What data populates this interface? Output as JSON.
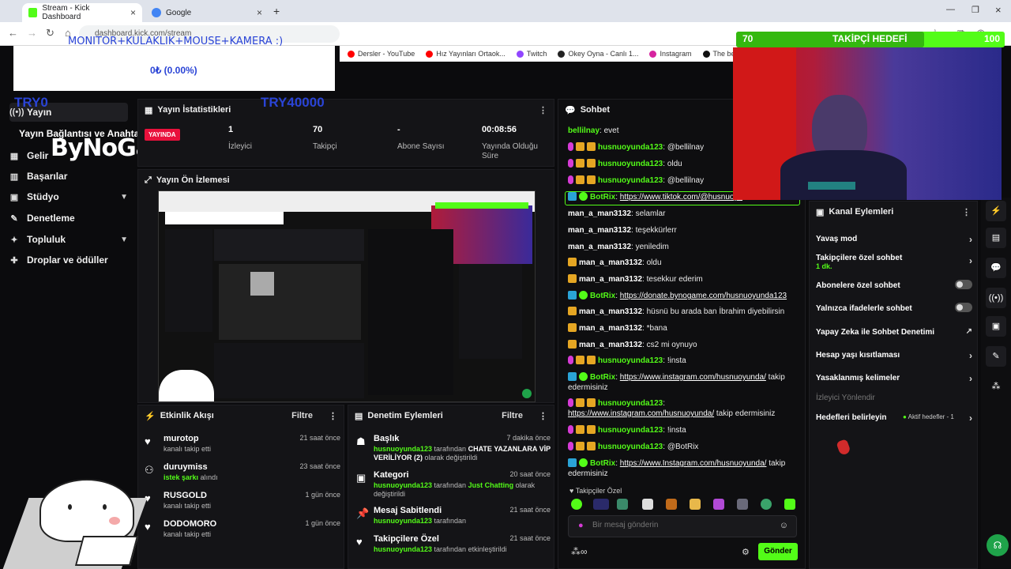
{
  "browser": {
    "tabs": [
      {
        "title": "Stream - Kick Dashboard",
        "active": true
      },
      {
        "title": "Google",
        "active": false
      }
    ],
    "address": "dashboard.kick.com/stream",
    "bookmarks": [
      "Dersler - YouTube",
      "Hız Yayınları Ortaok...",
      "Twitch",
      "Okey Oyna - Canlı 1...",
      "Instagram",
      "The best ChatBot a..."
    ]
  },
  "overlay": {
    "goal_title": "MONITOR+KULAKLIK+MOUSE+KAMERA :)",
    "goal_pct": "0₺ (0.00%)",
    "try_start": "TRY0",
    "try_end": "TRY40000",
    "follower_goal": {
      "current": "70",
      "title": "TAKİPÇİ HEDEFİ",
      "max": "100",
      "progress": 0.7
    },
    "bynogame_sub": "Yayın Bağlantısı ve Anahtarı",
    "bynogame_logo": "ByNoGame"
  },
  "sidebar": {
    "items": [
      {
        "label": "Yayın",
        "icon": "broadcast-icon"
      },
      {
        "label": "Gelir",
        "icon": "chart-icon"
      },
      {
        "label": "Başarılar",
        "icon": "trophy-icon"
      },
      {
        "label": "Stüdyo",
        "icon": "studio-icon"
      },
      {
        "label": "Denetleme",
        "icon": "wrench-icon"
      },
      {
        "label": "Topluluk",
        "icon": "community-icon"
      },
      {
        "label": "Droplar ve ödüller",
        "icon": "gift-icon"
      }
    ]
  },
  "stats": {
    "title": "Yayın İstatistikleri",
    "live": "YAYINDA",
    "items": [
      {
        "value": "1",
        "label": "İzleyici"
      },
      {
        "value": "70",
        "label": "Takipçi"
      },
      {
        "value": "-",
        "label": "Abone Sayısı"
      },
      {
        "value": "00:08:56",
        "label": "Yayında Olduğu Süre"
      }
    ]
  },
  "preview": {
    "title": "Yayın Ön İzlemesi"
  },
  "activity": {
    "title": "Etkinlik Akışı",
    "filter": "Filtre",
    "items": [
      {
        "name": "murotop",
        "sub": "kanalı takip etti",
        "time": "21 saat önce"
      },
      {
        "name": "duruymiss",
        "sub_green": "istek şarkı",
        "sub": "alındı",
        "time": "23 saat önce"
      },
      {
        "name": "RUSGOLD",
        "sub": "kanalı takip etti",
        "time": "1 gün önce"
      },
      {
        "name": "DODOMORO",
        "sub": "kanalı takip etti",
        "time": "1 gün önce"
      }
    ]
  },
  "moderation": {
    "title": "Denetim Eylemleri",
    "filter": "Filtre",
    "items": [
      {
        "name": "Başlık",
        "time": "7 dakika önce",
        "user": "husnuoyunda123",
        "text1": "tarafından",
        "highlight": "CHATE YAZANLARA VİP VERİLİYOR (2)",
        "text2": "olarak değiştirildi"
      },
      {
        "name": "Kategori",
        "time": "20 saat önce",
        "user": "husnuoyunda123",
        "text1": "tarafından",
        "highlight": "Just Chatting",
        "text2": "olarak değiştirildi"
      },
      {
        "name": "Mesaj Sabitlendi",
        "time": "21 saat önce",
        "user": "husnuoyunda123",
        "text1": "tarafından",
        "highlight": "",
        "text2": ""
      },
      {
        "name": "Takipçilere Özel",
        "time": "21 saat önce",
        "user": "husnuoyunda123",
        "text1": "tarafından etkinleştirildi",
        "highlight": "",
        "text2": ""
      }
    ]
  },
  "chat": {
    "title": "Sohbet",
    "messages": [
      {
        "user": "bellilnay",
        "text": "evet",
        "badges": []
      },
      {
        "user": "husnuoyunda123",
        "text": "@bellilnay",
        "badges": [
          "mic",
          "crown",
          "crown"
        ]
      },
      {
        "user": "husnuoyunda123",
        "text": "oldu",
        "badges": [
          "mic",
          "crown",
          "crown"
        ]
      },
      {
        "user": "husnuoyunda123",
        "text": "@bellilnay",
        "badges": [
          "mic",
          "crown",
          "crown"
        ]
      },
      {
        "user": "BotRix",
        "link": "https://www.tiktok.com/@husnuoyu",
        "badges": [
          "bot",
          "check"
        ]
      },
      {
        "user": "man_a_man3132",
        "text": "selamlar",
        "badges": []
      },
      {
        "user": "man_a_man3132",
        "text": "teşekkürlerr",
        "badges": []
      },
      {
        "user": "man_a_man3132",
        "text": "yeniledim",
        "badges": []
      },
      {
        "user": "man_a_man3132",
        "text": "oldu",
        "badges": [
          "crown"
        ]
      },
      {
        "user": "man_a_man3132",
        "text": "tesekkur ederim",
        "badges": [
          "crown"
        ]
      },
      {
        "user": "BotRix",
        "link": "https://donate.bynogame.com/husnuoyunda123",
        "badges": [
          "bot",
          "check"
        ]
      },
      {
        "user": "man_a_man3132",
        "text": "hüsnü bu arada ban İbrahim diyebilirsin",
        "badges": [
          "crown"
        ]
      },
      {
        "user": "man_a_man3132",
        "text": "*bana",
        "badges": [
          "crown"
        ]
      },
      {
        "user": "man_a_man3132",
        "text": "cs2 mi oynuyo",
        "badges": [
          "crown"
        ]
      },
      {
        "user": "husnuoyunda123",
        "text": "!insta",
        "badges": [
          "mic",
          "crown",
          "crown"
        ]
      },
      {
        "user": "BotRix",
        "link": "https://www.instagram.com/husnuoyunda/",
        "after": "takip edermisiniz",
        "badges": [
          "bot",
          "check"
        ]
      },
      {
        "user": "husnuoyunda123",
        "link": "https://www.instagram.com/husnuoyunda/",
        "after": "takip edermisiniz",
        "badges": [
          "mic",
          "crown",
          "crown"
        ]
      },
      {
        "user": "husnuoyunda123",
        "text": "!insta",
        "badges": [
          "mic",
          "crown",
          "crown"
        ]
      },
      {
        "user": "husnuoyunda123",
        "text": "@BotRix",
        "badges": [
          "mic",
          "crown",
          "crown"
        ]
      },
      {
        "user": "BotRix",
        "link": "https://www.Instagram.com/husnuoyunda/",
        "after": "takip edermisiniz",
        "badges": [
          "bot",
          "check"
        ]
      }
    ],
    "followers_only": "Takipçiler Özel",
    "input_placeholder": "Bir mesaj gönderin",
    "send_label": "Gönder"
  },
  "channel_actions": {
    "title": "Kanal Eylemleri",
    "items": [
      {
        "label": "Yavaş mod",
        "control": "chevron"
      },
      {
        "label": "Takipçilere özel sohbet",
        "sub": "1 dk.",
        "control": "chevron"
      },
      {
        "label": "Abonelere özel sohbet",
        "control": "toggle"
      },
      {
        "label": "Yalnızca ifadelerle sohbet",
        "control": "toggle"
      },
      {
        "label": "Yapay Zeka ile Sohbet Denetimi",
        "control": "external"
      },
      {
        "label": "Hesap yaşı kısıtlaması",
        "control": "chevron"
      },
      {
        "label": "Yasaklanmış kelimeler",
        "control": "chevron"
      },
      {
        "label": "İzleyici Yönlendir",
        "control": "none",
        "disabled": true
      },
      {
        "label": "Hedefleri belirleyin",
        "extra": "Aktif hedefler - 1",
        "control": "chevron"
      }
    ]
  },
  "colors": {
    "accent": "#53fc18",
    "live": "#e9113c",
    "overlay_blue": "#2a44d6"
  }
}
